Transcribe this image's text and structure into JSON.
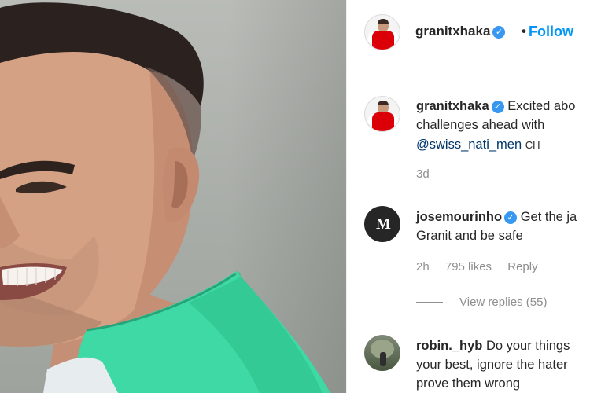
{
  "post": {
    "author": "granitxhaka",
    "follow_label": "Follow",
    "separator": "•"
  },
  "caption": {
    "author": "granitxhaka",
    "line1": "Excited abo",
    "line2": "challenges ahead with",
    "mention": "@swiss_nati_men",
    "tail": "CH",
    "time": "3d"
  },
  "comments": [
    {
      "author": "josemourinho",
      "avatar_text": "M",
      "line1": "Get the ja",
      "line2": "Granit and be safe",
      "time": "2h",
      "likes": "795 likes",
      "reply": "Reply",
      "view_replies": "View replies (55)"
    },
    {
      "author": "robin._hyb",
      "line1": "Do your things",
      "line2": "your best, ignore the hater",
      "line3": "prove them wrong"
    }
  ],
  "icons": {
    "verified": "verified-badge-icon"
  },
  "colors": {
    "follow": "#0095f6",
    "verified": "#3897f0",
    "arsenal_red": "#db0007",
    "jersey_green": "#3ed9a4"
  }
}
